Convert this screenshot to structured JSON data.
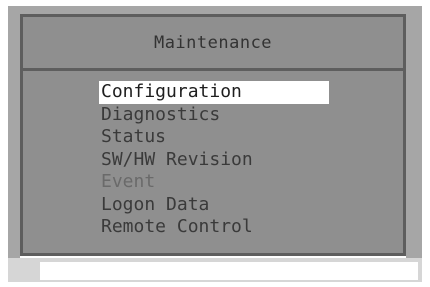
{
  "title": "Maintenance",
  "menu": {
    "items": [
      {
        "label": "Configuration",
        "selected": true,
        "enabled": true
      },
      {
        "label": "Diagnostics",
        "selected": false,
        "enabled": true
      },
      {
        "label": "Status",
        "selected": false,
        "enabled": true
      },
      {
        "label": "SW/HW Revision",
        "selected": false,
        "enabled": true
      },
      {
        "label": "Event",
        "selected": false,
        "enabled": false
      },
      {
        "label": "Logon Data",
        "selected": false,
        "enabled": true
      },
      {
        "label": "Remote Control",
        "selected": false,
        "enabled": true
      }
    ]
  },
  "colors": {
    "panel": "#8f8f8f",
    "border": "#5e5e5e",
    "text": "#3a3a3a",
    "selection": "#ffffff"
  }
}
